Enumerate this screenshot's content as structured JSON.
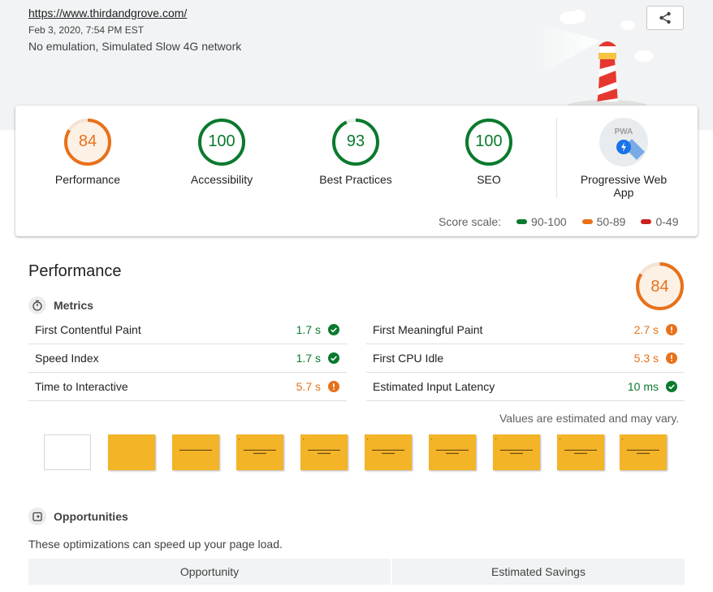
{
  "header": {
    "url": "https://www.thirdandgrove.com/",
    "date": "Feb 3, 2020, 7:54 PM EST",
    "environment": "No emulation, Simulated Slow 4G network",
    "share_icon": "share-icon"
  },
  "colors": {
    "pass": "#0a7a2e",
    "average": "#e8711a",
    "fail": "#cc1f1f"
  },
  "categories": [
    {
      "label": "Performance",
      "score": "84",
      "status": "average",
      "fraction": 0.84
    },
    {
      "label": "Accessibility",
      "score": "100",
      "status": "pass",
      "fraction": 1.0
    },
    {
      "label": "Best Practices",
      "score": "93",
      "status": "pass",
      "fraction": 0.93
    },
    {
      "label": "SEO",
      "score": "100",
      "status": "pass",
      "fraction": 1.0
    },
    {
      "label": "Progressive Web App",
      "badge": "PWA",
      "status": "pwa"
    }
  ],
  "score_scale": {
    "label": "Score scale:",
    "ranges": [
      "90-100",
      "50-89",
      "0-49"
    ]
  },
  "performance": {
    "title": "Performance",
    "score": "84",
    "fraction": 0.84,
    "metrics_label": "Metrics",
    "metrics_left": [
      {
        "name": "First Contentful Paint",
        "value": "1.7 s",
        "status": "pass"
      },
      {
        "name": "Speed Index",
        "value": "1.7 s",
        "status": "pass"
      },
      {
        "name": "Time to Interactive",
        "value": "5.7 s",
        "status": "average"
      }
    ],
    "metrics_right": [
      {
        "name": "First Meaningful Paint",
        "value": "2.7 s",
        "status": "average"
      },
      {
        "name": "First CPU Idle",
        "value": "5.3 s",
        "status": "average"
      },
      {
        "name": "Estimated Input Latency",
        "value": "10 ms",
        "status": "pass"
      }
    ],
    "estimated_note": "Values are estimated and may vary."
  },
  "opportunities": {
    "label": "Opportunities",
    "description": "These optimizations can speed up your page load.",
    "columns": [
      "Opportunity",
      "Estimated Savings"
    ]
  }
}
